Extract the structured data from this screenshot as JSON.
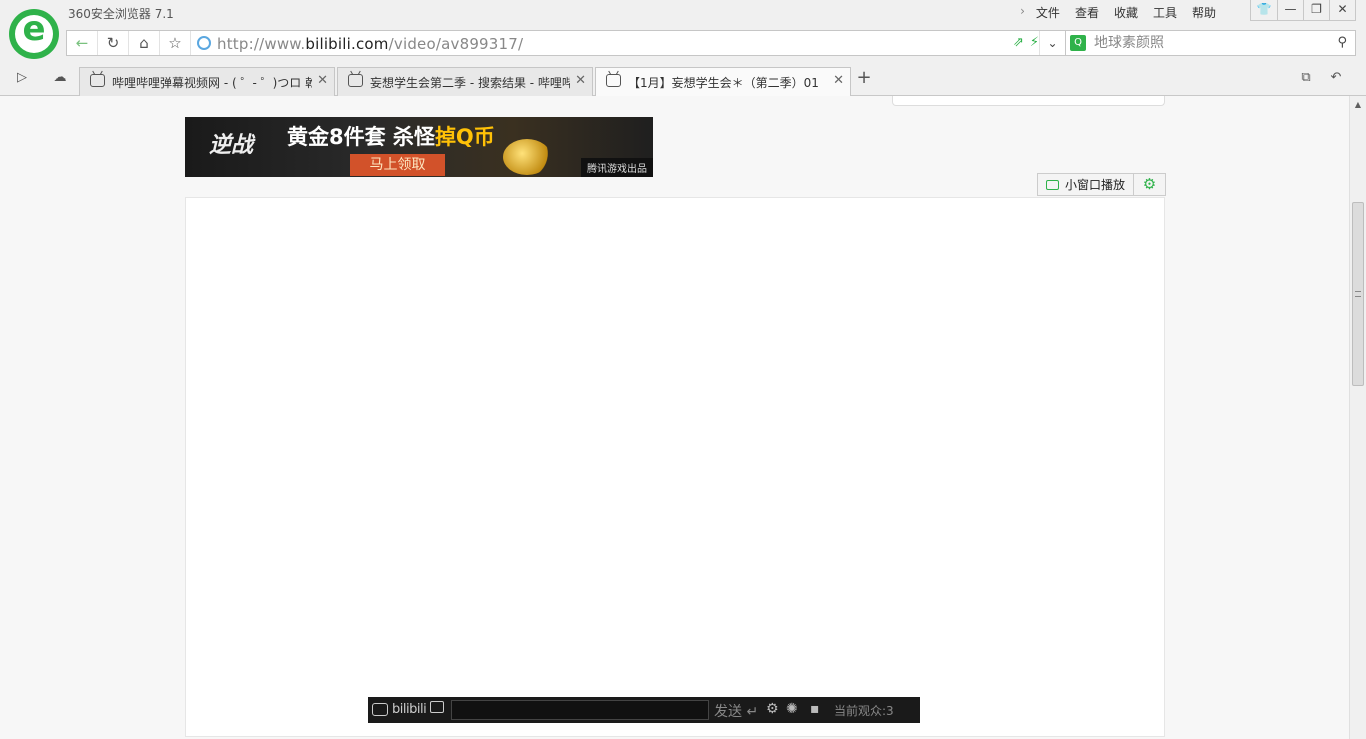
{
  "window": {
    "title": "360安全浏览器 7.1",
    "menu": [
      "文件",
      "查看",
      "收藏",
      "工具",
      "帮助"
    ],
    "menu_expand_icon": "chevron-right-icon",
    "controls": [
      "shirt-skin-icon",
      "minimize-icon",
      "restore-icon",
      "close-icon"
    ]
  },
  "address_bar": {
    "url_prefix": "http://www.",
    "url_domain": "bilibili.com",
    "url_path": "/video/av899317/",
    "search_placeholder": "地球素颜照"
  },
  "tabs": [
    {
      "title": "哔哩哔哩弹幕视频网 - ( ゜- ゜)つロ 乾杯~",
      "active": false
    },
    {
      "title": "妄想学生会第二季 - 搜索结果 - 哔哩哔哩弹幕视频网",
      "active": false
    },
    {
      "title": "【1月】妄想学生会＊（第二季）01",
      "active": true
    }
  ],
  "ad": {
    "logo_text": "逆战",
    "headline_prefix": "黄金8件套 杀怪",
    "headline_highlight": "掉Q币",
    "cta": "马上领取",
    "tag": "腾讯游戏出品"
  },
  "player": {
    "pip_label": "小窗口播放",
    "danmaku": {
      "logo": "bilibili",
      "input_value": "",
      "send_label": "发送",
      "viewers_label": "当前观众:3"
    }
  },
  "colors": {
    "accent": "#2fb24a",
    "ad_highlight": "#ffc107",
    "ad_cta": "#d2522a"
  }
}
